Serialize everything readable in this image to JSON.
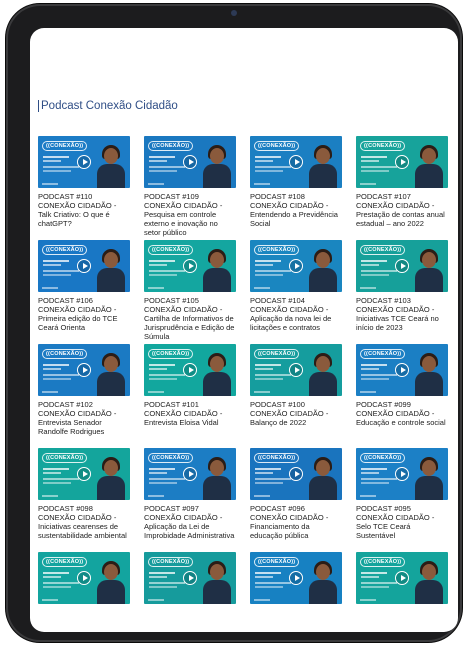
{
  "page": {
    "title": "Podcast Conexão Cidadão"
  },
  "colors": {
    "frame": "#1c1c1e",
    "title": "#2f4e86",
    "blue": "#1f7fc4",
    "teal": "#13a2a0"
  },
  "thumbnail": {
    "logo_text": "((CONEXÃO))"
  },
  "episodes": [
    {
      "caption": "PODCAST #110 CONEXÃO CIDADÃO - Talk Criativo: O que é chatGPT?",
      "bg": "#1c7cc6"
    },
    {
      "caption": "PODCAST #109 CONEXÃO CIDADÃO - Pesquisa em controle externo e inovação no setor público",
      "bg": "#1a78c0"
    },
    {
      "caption": "PODCAST #108 CONEXÃO CIDADÃO - Entendendo a Previdência Social",
      "bg": "#1b7fc2"
    },
    {
      "caption": "PODCAST #107 CONEXÃO CIDADÃO - Prestação de contas anual estadual – ano 2022",
      "bg": "#17a39b"
    },
    {
      "caption": "PODCAST #106 CONEXÃO CIDADÃO - Primeira edição do TCE Ceará Orienta",
      "bg": "#1977c5"
    },
    {
      "caption": "PODCAST #105 CONEXÃO CIDADÃO - Cartilha de Informativos de Jurisprudência e Edição de Súmula",
      "bg": "#14a6a0"
    },
    {
      "caption": "PODCAST #104 CONEXÃO CIDADÃO - Aplicação da nova lei de licitações e contratos",
      "bg": "#1a86c0"
    },
    {
      "caption": "PODCAST #103 CONEXÃO CIDADÃO - Iniciativas TCE Ceará no início de 2023",
      "bg": "#16a09a"
    },
    {
      "caption": "PODCAST #102 CONEXÃO CIDADÃO - Entrevista Senador Randolfe Rodrigues",
      "bg": "#1b7ac3"
    },
    {
      "caption": "PODCAST #101 CONEXÃO CIDADÃO - Entrevista Eloisa Vidal",
      "bg": "#12a79e"
    },
    {
      "caption": "PODCAST #100 CONEXÃO CIDADÃO - Balanço de 2022",
      "bg": "#159d9e"
    },
    {
      "caption": "PODCAST #099 CONEXÃO CIDADÃO - Educação e controle social",
      "bg": "#1b7fc4"
    },
    {
      "caption": "PODCAST #098 CONEXÃO CIDADÃO - Iniciativas cearenses de sustentabilidade ambiental",
      "bg": "#14a59c"
    },
    {
      "caption": "PODCAST #097 CONEXÃO CIDADÃO - Aplicação da Lei de Improbidade Administrativa",
      "bg": "#1c7dc4"
    },
    {
      "caption": "PODCAST #096 CONEXÃO CIDADÃO - Financiamento da educação pública",
      "bg": "#1a74be"
    },
    {
      "caption": "PODCAST #095 CONEXÃO CIDADÃO - Selo TCE Ceará Sustentável",
      "bg": "#1c80c6"
    },
    {
      "caption": "",
      "bg": "#13a49f"
    },
    {
      "caption": "",
      "bg": "#169b9c"
    },
    {
      "caption": "",
      "bg": "#1781c2"
    },
    {
      "caption": "",
      "bg": "#14a49c"
    }
  ]
}
